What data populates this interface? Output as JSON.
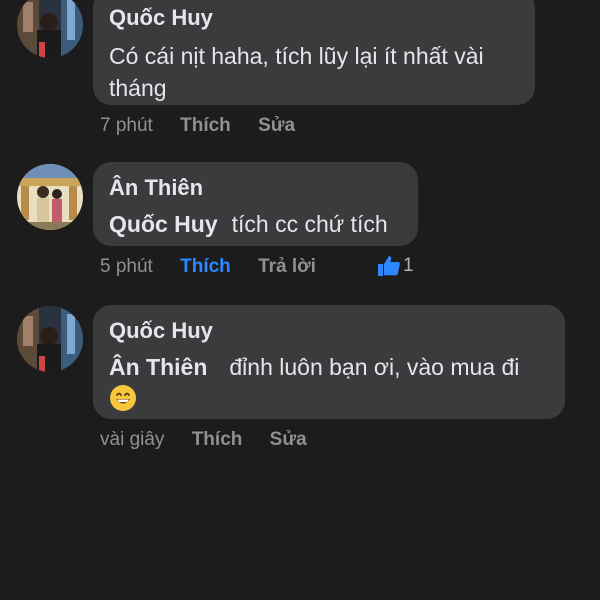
{
  "comments": [
    {
      "author": "Quốc Huy",
      "mention": "",
      "text": "Có cái nịt haha, tích lũy lại ít nhất vài tháng",
      "time": "7 phút",
      "like_label": "Thích",
      "second_action": "Sửa",
      "avatar_icon": "user-photo-avatar"
    },
    {
      "author": "Ân Thiên",
      "mention": "Quốc Huy",
      "text": "tích cc chứ tích",
      "time": "5 phút",
      "like_label": "Thích",
      "like_state": "liked",
      "second_action": "Trả lời",
      "reaction_icon": "thumbs-up-icon",
      "reaction_count": "1",
      "avatar_icon": "user-photo-avatar"
    },
    {
      "author": "Quốc Huy",
      "mention": "Ân Thiên",
      "text": "đỉnh luôn bạn ơi, vào mua đi",
      "emoji": "grinning-face-emoji",
      "time": "vài giây",
      "like_label": "Thích",
      "second_action": "Sửa",
      "avatar_icon": "user-photo-avatar"
    }
  ],
  "colors": {
    "background": "#1c1c1d",
    "bubble": "#3a3b3c",
    "text": "#e4e6eb",
    "meta": "#8e9094",
    "liked": "#2d88ff"
  }
}
